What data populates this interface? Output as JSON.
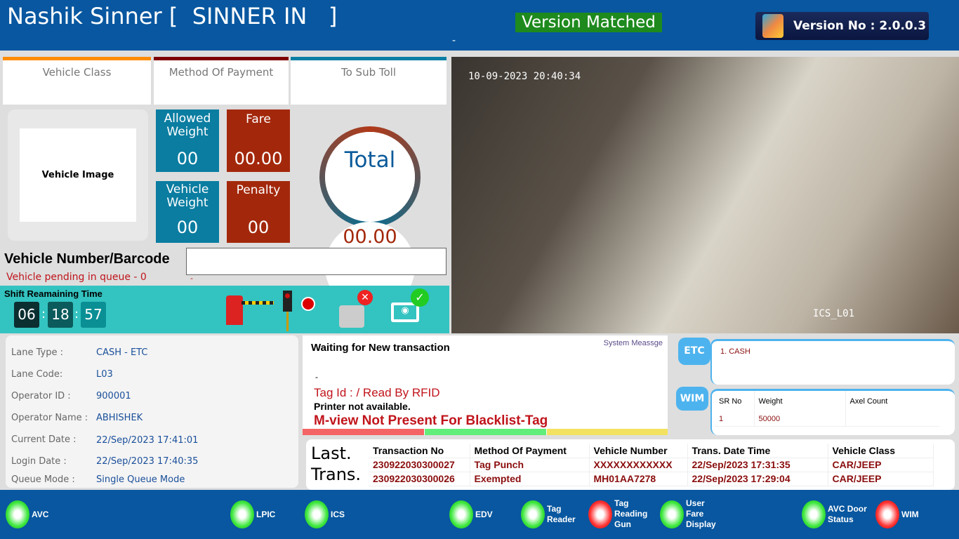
{
  "header": {
    "title": "Nashik Sinner [  SINNER IN   ]",
    "version_status": "Version Matched",
    "version": "Version No : 2.0.0.3",
    "dash": "-"
  },
  "cards": [
    {
      "label": "Vehicle Class",
      "color": "#ff8c00"
    },
    {
      "label": "Method Of Payment",
      "color": "#7f0000"
    },
    {
      "label": "To Sub Toll",
      "color": "#0a7ea4"
    }
  ],
  "vehicle_image_label": "Vehicle Image",
  "tiles": {
    "allowed_weight": {
      "label": "Allowed Weight",
      "value": "00"
    },
    "fare": {
      "label": "Fare",
      "value": "00.00"
    },
    "vehicle_weight": {
      "label": "Vehicle Weight",
      "value": "00"
    },
    "penalty": {
      "label": "Penalty",
      "value": "00"
    }
  },
  "total": {
    "label": "Total",
    "value": "00.00"
  },
  "vehicle_number": {
    "label": "Vehicle Number/Barcode",
    "value": "",
    "queue": "Vehicle pending in queue - 0",
    "dash": "-"
  },
  "shift": {
    "label": "Shift Reamaining Time",
    "hh": "06",
    "mm": "18",
    "ss": "57"
  },
  "camera": {
    "timestamp": "10-09-2023 20:40:34",
    "name": "ICS_L01"
  },
  "info": [
    {
      "label": "Lane Type :",
      "value": "CASH - ETC"
    },
    {
      "label": "Lane Code:",
      "value": "L03"
    },
    {
      "label": "Operator ID :",
      "value": "900001"
    },
    {
      "label": "Operator Name :",
      "value": "ABHISHEK"
    },
    {
      "label": "Current Date :",
      "value": "22/Sep/2023 17:41:01"
    },
    {
      "label": "Login Date :",
      "value": "22/Sep/2023 17:40:35"
    },
    {
      "label": "Queue Mode :",
      "value": "Single Queue Mode"
    }
  ],
  "system": {
    "title": "System Meassge",
    "waiting": "Waiting for New transaction",
    "tag": "Tag Id : / Read By RFID",
    "printer": "Printer not available.",
    "mview": "M-view Not Present For Blacklist-Tag",
    "dot": "-"
  },
  "etc": {
    "label": "ETC",
    "item": "1. CASH"
  },
  "wim": {
    "label": "WIM",
    "headers": [
      "SR No",
      "Weight",
      "Axel Count"
    ],
    "rows": [
      [
        "1",
        "50000",
        ""
      ]
    ]
  },
  "last": {
    "label1": "Last.",
    "label2": "Trans.",
    "headers": [
      "Transaction No",
      "Method Of Payment",
      "Vehicle Number",
      "Trans. Date Time",
      "Vehicle Class"
    ],
    "rows": [
      [
        "230922030300027",
        "Tag Punch",
        "XXXXXXXXXXXX",
        "22/Sep/2023 17:31:35",
        "CAR/JEEP"
      ],
      [
        "230922030300026",
        "Exempted",
        "MH01AA7278",
        "22/Sep/2023 17:29:04",
        "CAR/JEEP"
      ]
    ]
  },
  "footer": [
    {
      "label": "AVC",
      "status": "ok"
    },
    {
      "label": "LPIC",
      "status": "ok"
    },
    {
      "label": "ICS",
      "status": "ok"
    },
    {
      "label": "EDV",
      "status": "ok"
    },
    {
      "label": "Tag Reader",
      "status": "ok"
    },
    {
      "label": "Tag Reading Gun",
      "status": "error"
    },
    {
      "label": "User Fare Display",
      "status": "ok"
    },
    {
      "label": "AVC Door Status",
      "status": "ok"
    },
    {
      "label": "WIM",
      "status": "error"
    }
  ]
}
